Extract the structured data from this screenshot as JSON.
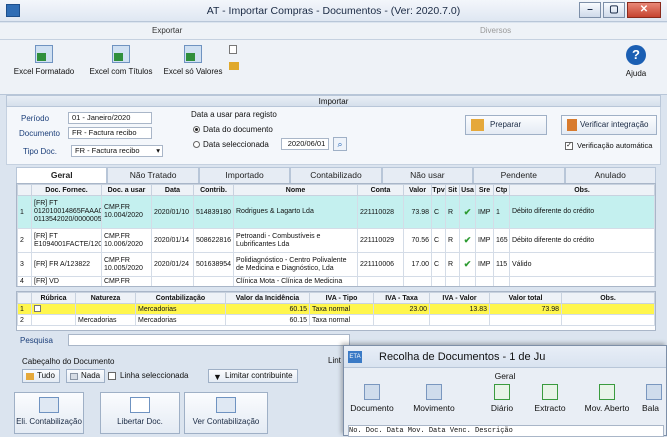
{
  "window": {
    "title": "AT - Importar Compras - Documentos - (Ver: 2020.7.0)"
  },
  "ribbon": {
    "tab_exportar": "Exportar",
    "tab_diversos": "Diversos",
    "btn_excel_formatado": "Excel Formatado",
    "btn_excel_titulos": "Excel com Títulos",
    "btn_excel_valores": "Excel só Valores",
    "btn_ajuda": "Ajuda"
  },
  "section": {
    "importar": "Importar"
  },
  "filters": {
    "periodo_label": "Período",
    "periodo_value": "01 - Janeiro/2020",
    "documento_label": "Documento",
    "documento_value": "FR - Factura recibo",
    "tipo_label": "Tipo Doc.",
    "tipo_value": "FR - Factura recibo",
    "data_registo_label": "Data a usar para registo",
    "opt_data_documento": "Data do documento",
    "opt_data_selecionada": "Data seleccionada",
    "date_value": "2020/06/01",
    "preparar": "Preparar",
    "verificar": "Verificar integração",
    "verificacao_auto": "Verificação automática"
  },
  "tabs": [
    "Geral",
    "Não Tratado",
    "Importado",
    "Contabilizado",
    "Não usar",
    "Pendente",
    "Anulado"
  ],
  "grid1": {
    "headers": [
      "",
      "Doc. Fornec.",
      "Doc. a usar",
      "Data",
      "Contrib.",
      "Nome",
      "Conta",
      "Valor",
      "Tpv",
      "Sit",
      "Usa",
      "Sre",
      "Ctp",
      "Obs."
    ],
    "rows": [
      {
        "n": "1",
        "doc": "[FR] FT 012010014865FAAA0000 0113542020/000000561",
        "usar": "CMP.FR 10.004/2020",
        "data": "2020/01/10",
        "contrib": "514839180",
        "nome": "Rodrigues & Lagarto Lda",
        "conta": "221110028",
        "valor": "73.98",
        "tpv": "C",
        "sit": "R",
        "usa": "✔",
        "sre": "IMP",
        "ctp": "1",
        "obs": "Débito diferente do crédito"
      },
      {
        "n": "2",
        "doc": "[FR] FT E1094001FACTE/12080",
        "usar": "CMP.FR 10.006/2020",
        "data": "2020/01/14",
        "contrib": "508622816",
        "nome": "Petroandi - Combustíveis e Lubrificantes Lda",
        "conta": "221110029",
        "valor": "70.56",
        "tpv": "C",
        "sit": "R",
        "usa": "✔",
        "sre": "IMP",
        "ctp": "165",
        "obs": "Débito diferente do crédito"
      },
      {
        "n": "3",
        "doc": "[FR] FR A/123822",
        "usar": "CMP.FR 10.005/2020",
        "data": "2020/01/24",
        "contrib": "501638954",
        "nome": "Polidiagnóstico - Centro Polivalente de Medicina e Diagnóstico, Lda",
        "conta": "221110006",
        "valor": "17.00",
        "tpv": "C",
        "sit": "R",
        "usa": "✔",
        "sre": "IMP",
        "ctp": "115",
        "obs": "Válido"
      },
      {
        "n": "4",
        "doc": "[FR] VD",
        "usar": "CMP.FR",
        "data": "",
        "contrib": "",
        "nome": "Clínica Mota - Clínica de Medicina",
        "conta": "",
        "valor": "",
        "tpv": "",
        "sit": "",
        "usa": "",
        "sre": "",
        "ctp": "",
        "obs": ""
      }
    ]
  },
  "grid2": {
    "headers": [
      "",
      "Rúbrica",
      "Natureza",
      "Contabilização",
      "Valor da Incidência",
      "IVA - Tipo",
      "IVA - Taxa",
      "IVA - Valor",
      "Valor total",
      "Obs."
    ],
    "rows": [
      {
        "n": "1",
        "rubrica": "",
        "natureza": "",
        "contab": "Mercadorias",
        "incid": "60.15",
        "tipo": "Taxa normal",
        "taxa": "23.00",
        "valor": "13.83",
        "total": "73.98",
        "obs": ""
      },
      {
        "n": "2",
        "rubrica": "",
        "natureza": "Mercadorias",
        "contab": "Mercadorias",
        "incid": "60.15",
        "tipo": "Taxa normal",
        "taxa": "",
        "valor": "",
        "total": "",
        "obs": ""
      }
    ]
  },
  "pesquisa": {
    "label": "Pesquisa"
  },
  "cabecalho": {
    "label": "Cabeçalho do Documento",
    "tudo": "Tudo",
    "nada": "Nada",
    "linha": "Linha seleccionada",
    "limitar": "Limitar contribuinte",
    "lint": "Lint"
  },
  "footer": {
    "eli": "Eli. Contabilização",
    "libertar": "Libertar Doc.",
    "ver": "Ver Contabilização"
  },
  "popup": {
    "title": "Recolha de Documentos - 1 de Ju",
    "badge": "ETA",
    "geral": "Geral",
    "tools": [
      "Documento",
      "Movimento",
      "Diário",
      "Extracto",
      "Mov. Aberto",
      "Bala"
    ],
    "grid_header": "No. Doc.  Data Mov.  Data Venc.            Descrição"
  }
}
